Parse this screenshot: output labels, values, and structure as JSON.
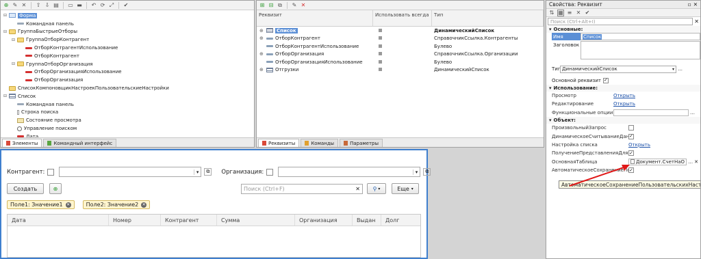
{
  "left_panel": {
    "tree": [
      {
        "level": 0,
        "icon": "form-icon",
        "label": "Форма",
        "selected": true
      },
      {
        "level": 1,
        "icon": "command-bar-icon",
        "label": "Командная панель"
      },
      {
        "level": 0,
        "icon": "folder-icon",
        "label": "ГруппаБыстрыеОтборы"
      },
      {
        "level": 1,
        "icon": "folder-icon",
        "label": "ГруппаОтборКонтрагент"
      },
      {
        "level": 2,
        "icon": "field-icon",
        "label": "ОтборКонтрагентИспользование"
      },
      {
        "level": 2,
        "icon": "field-icon",
        "label": "ОтборКонтрагент"
      },
      {
        "level": 1,
        "icon": "folder-icon",
        "label": "ГруппаОтборОрганизация"
      },
      {
        "level": 2,
        "icon": "field-icon",
        "label": "ОтборОрганизацияИспользование"
      },
      {
        "level": 2,
        "icon": "field-icon",
        "label": "ОтборОрганизация"
      },
      {
        "level": 0,
        "icon": "folder-icon",
        "label": "СписокКомпоновщикНастроекПользовательскиеНастройки"
      },
      {
        "level": 0,
        "icon": "table-icon",
        "label": "Список"
      },
      {
        "level": 1,
        "icon": "command-bar-icon",
        "label": "Командная панель"
      },
      {
        "level": 1,
        "icon": "search-line-icon",
        "label": "Строка поиска"
      },
      {
        "level": 1,
        "icon": "state-icon",
        "label": "Состояние просмотра"
      },
      {
        "level": 1,
        "icon": "search-icon",
        "label": "Управление поиском"
      },
      {
        "level": 1,
        "icon": "field-icon",
        "label": "Дата"
      }
    ],
    "tabs": [
      {
        "label": "Элементы",
        "active": true
      },
      {
        "label": "Командный интерфейс",
        "active": false
      }
    ]
  },
  "middle_panel": {
    "columns": {
      "name": "Реквизит",
      "use_always": "Использовать всегда",
      "type": "Тип"
    },
    "rows": [
      {
        "expand": "⊕",
        "icon": "table-icon",
        "name": "Список",
        "checked": false,
        "type": "ДинамическийСписок",
        "selected": true,
        "bold": true
      },
      {
        "expand": "⊕",
        "icon": "field-icon",
        "name": "ОтборКонтрагент",
        "checked": false,
        "type": "СправочникСсылка.Контрагенты"
      },
      {
        "expand": "",
        "icon": "field-icon",
        "name": "ОтборКонтрагентИспользование",
        "checked": false,
        "type": "Булево"
      },
      {
        "expand": "⊕",
        "icon": "field-icon",
        "name": "ОтборОрганизация",
        "checked": false,
        "type": "СправочникСсылка.Организации"
      },
      {
        "expand": "",
        "icon": "field-icon",
        "name": "ОтборОрганизацияИспользование",
        "checked": false,
        "type": "Булево"
      },
      {
        "expand": "⊕",
        "icon": "table-icon",
        "name": "Отгрузки",
        "checked": false,
        "type": "ДинамическийСписок"
      }
    ],
    "tabs": [
      {
        "label": "Реквизиты",
        "active": true
      },
      {
        "label": "Команды",
        "active": false
      },
      {
        "label": "Параметры",
        "active": false
      }
    ]
  },
  "properties": {
    "title": "Свойства: Реквизит",
    "search_placeholder": "Поиск (Ctrl+Alt+I)",
    "groups": {
      "basic": "Основные:",
      "usage": "Использование:",
      "object": "Объект:"
    },
    "name_label": "Имя",
    "name_value": "Список",
    "header_label": "Заголовок",
    "type_label": "Тип",
    "type_value": "ДинамическийСписок",
    "main_attr_label": "Основной реквизит",
    "usage_rows": [
      {
        "label": "Просмотр",
        "value": "Открыть"
      },
      {
        "label": "Редактирование",
        "value": "Открыть"
      },
      {
        "label": "Функциональные опции",
        "value": ""
      }
    ],
    "object_rows": [
      {
        "label": "ПроизвольныйЗапрос",
        "kind": "checkbox",
        "checked": false
      },
      {
        "label": "ДинамическоеСчитываниеДанн",
        "kind": "checkbox",
        "checked": true
      },
      {
        "label": "Настройка списка",
        "kind": "link",
        "value": "Открыть"
      },
      {
        "label": "ПолучениеПредставленияДля",
        "kind": "checkbox",
        "checked": true
      },
      {
        "label": "ОсновнаяТаблица",
        "kind": "table",
        "value": "Документ.СчетНаО"
      },
      {
        "label": "АвтоматическоеСохранениеПо",
        "kind": "checkbox",
        "checked": true
      }
    ],
    "tooltip": "АвтоматическоеСохранениеПользовательскихНастроек"
  },
  "preview": {
    "contractor_label": "Контрагент:",
    "organization_label": "Организация:",
    "create_button": "Создать",
    "search_placeholder": "Поиск (Ctrl+F)",
    "more_button": "Еще",
    "chips": [
      "Поле1: Значение1",
      "Поле2: Значение2"
    ],
    "columns": [
      "Дата",
      "Номер",
      "Контрагент",
      "Сумма",
      "Организация",
      "Выдан",
      "Долг"
    ]
  },
  "colors": {
    "selection": "#5b8fd6",
    "link": "#1a4fa8",
    "preview_border": "#3f7fce",
    "arrow": "#e01818"
  }
}
